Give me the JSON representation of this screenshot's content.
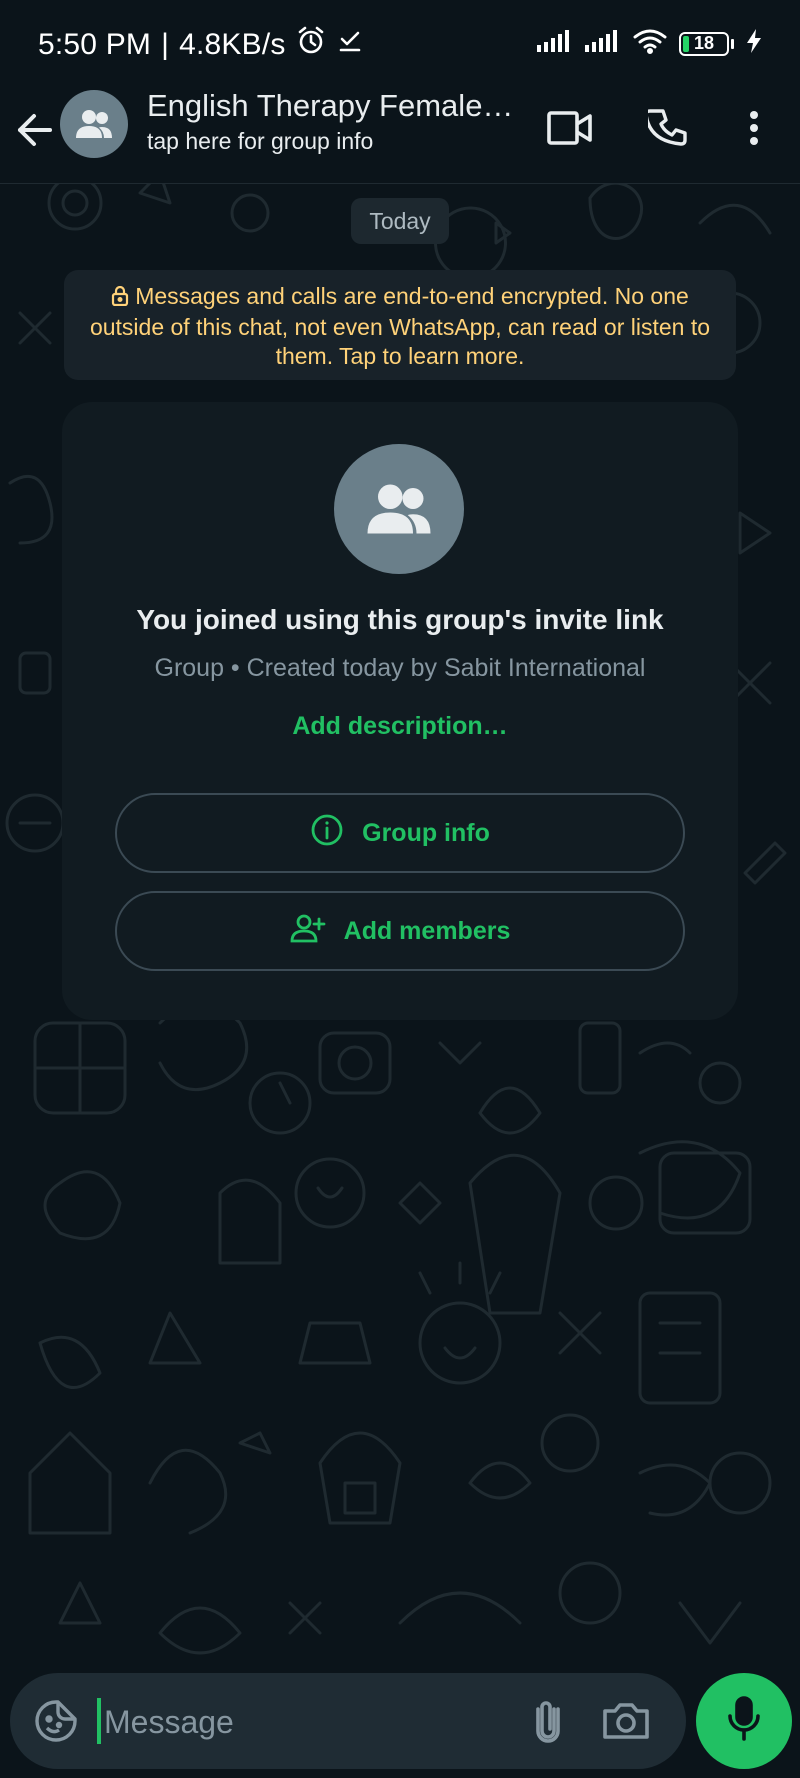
{
  "status_bar": {
    "time": "5:50 PM",
    "separator": "|",
    "net_speed": "4.8KB/s",
    "battery_level": "18",
    "icons": [
      "alarm-icon",
      "download-done-icon",
      "signal-icon",
      "signal-icon",
      "wifi-icon",
      "battery-icon",
      "charging-icon"
    ]
  },
  "header": {
    "title": "English Therapy Female…",
    "subtitle": "tap here for group info",
    "icons": [
      "back-arrow-icon",
      "group-avatar-icon",
      "video-call-icon",
      "voice-call-icon",
      "more-vert-icon"
    ]
  },
  "chat": {
    "date_chip": "Today",
    "encryption_notice": "Messages and calls are end-to-end encrypted. No one outside of this chat, not even WhatsApp, can read or listen to them. Tap to learn more."
  },
  "group_card": {
    "title": "You joined using this group's invite link",
    "subtitle": "Group • Created today by Sabit International",
    "add_description": "Add description…",
    "group_info_label": "Group info",
    "add_members_label": "Add members"
  },
  "composer": {
    "placeholder": "Message",
    "icons": [
      "emoji-sticker-icon",
      "attach-icon",
      "camera-icon",
      "mic-icon"
    ]
  },
  "colors": {
    "background": "#0b141a",
    "accent": "#21c063",
    "notice_text": "#ffd279",
    "card": "#111b21",
    "composer": "#1f2c34"
  }
}
